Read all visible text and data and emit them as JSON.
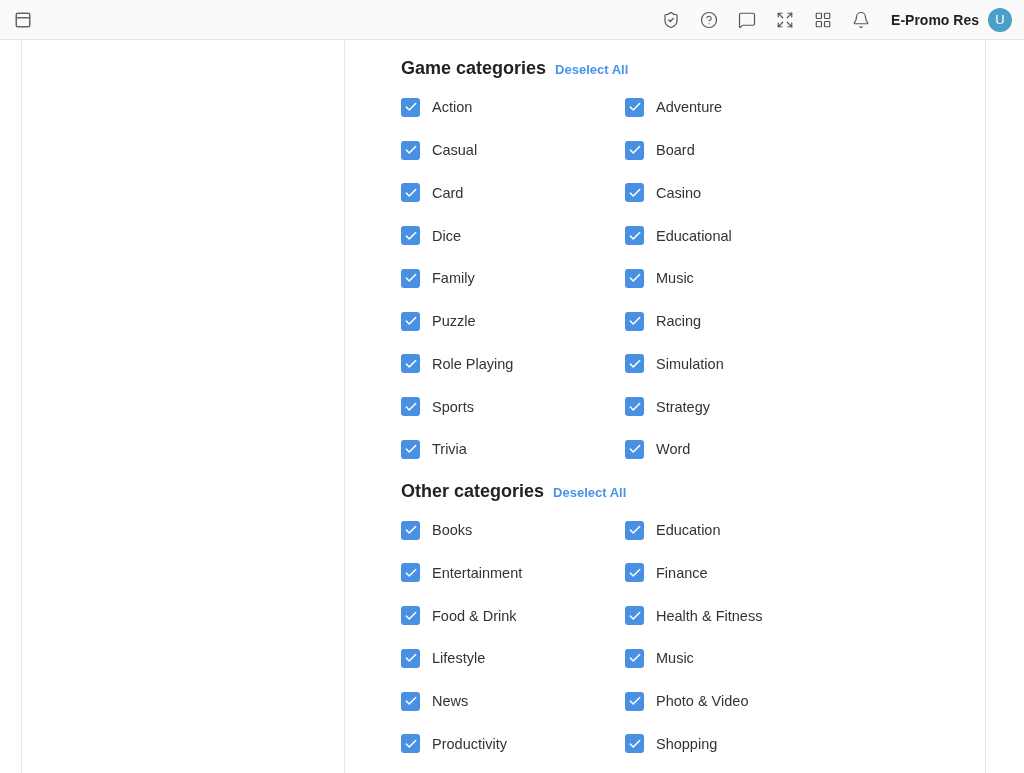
{
  "topbar": {
    "user_name": "E-Promo Res",
    "avatar_initial": "U"
  },
  "sections": [
    {
      "title": "Game categories",
      "action": "Deselect All",
      "items": [
        {
          "label": "Action",
          "checked": true
        },
        {
          "label": "Adventure",
          "checked": true
        },
        {
          "label": "Casual",
          "checked": true
        },
        {
          "label": "Board",
          "checked": true
        },
        {
          "label": "Card",
          "checked": true
        },
        {
          "label": "Casino",
          "checked": true
        },
        {
          "label": "Dice",
          "checked": true
        },
        {
          "label": "Educational",
          "checked": true
        },
        {
          "label": "Family",
          "checked": true
        },
        {
          "label": "Music",
          "checked": true
        },
        {
          "label": "Puzzle",
          "checked": true
        },
        {
          "label": "Racing",
          "checked": true
        },
        {
          "label": "Role Playing",
          "checked": true
        },
        {
          "label": "Simulation",
          "checked": true
        },
        {
          "label": "Sports",
          "checked": true
        },
        {
          "label": "Strategy",
          "checked": true
        },
        {
          "label": "Trivia",
          "checked": true
        },
        {
          "label": "Word",
          "checked": true
        }
      ]
    },
    {
      "title": "Other categories",
      "action": "Deselect All",
      "items": [
        {
          "label": "Books",
          "checked": true
        },
        {
          "label": "Education",
          "checked": true
        },
        {
          "label": "Entertainment",
          "checked": true
        },
        {
          "label": "Finance",
          "checked": true
        },
        {
          "label": "Food & Drink",
          "checked": true
        },
        {
          "label": "Health & Fitness",
          "checked": true
        },
        {
          "label": "Lifestyle",
          "checked": true
        },
        {
          "label": "Music",
          "checked": true
        },
        {
          "label": "News",
          "checked": true
        },
        {
          "label": "Photo & Video",
          "checked": true
        },
        {
          "label": "Productivity",
          "checked": true
        },
        {
          "label": "Shopping",
          "checked": true
        }
      ]
    }
  ]
}
